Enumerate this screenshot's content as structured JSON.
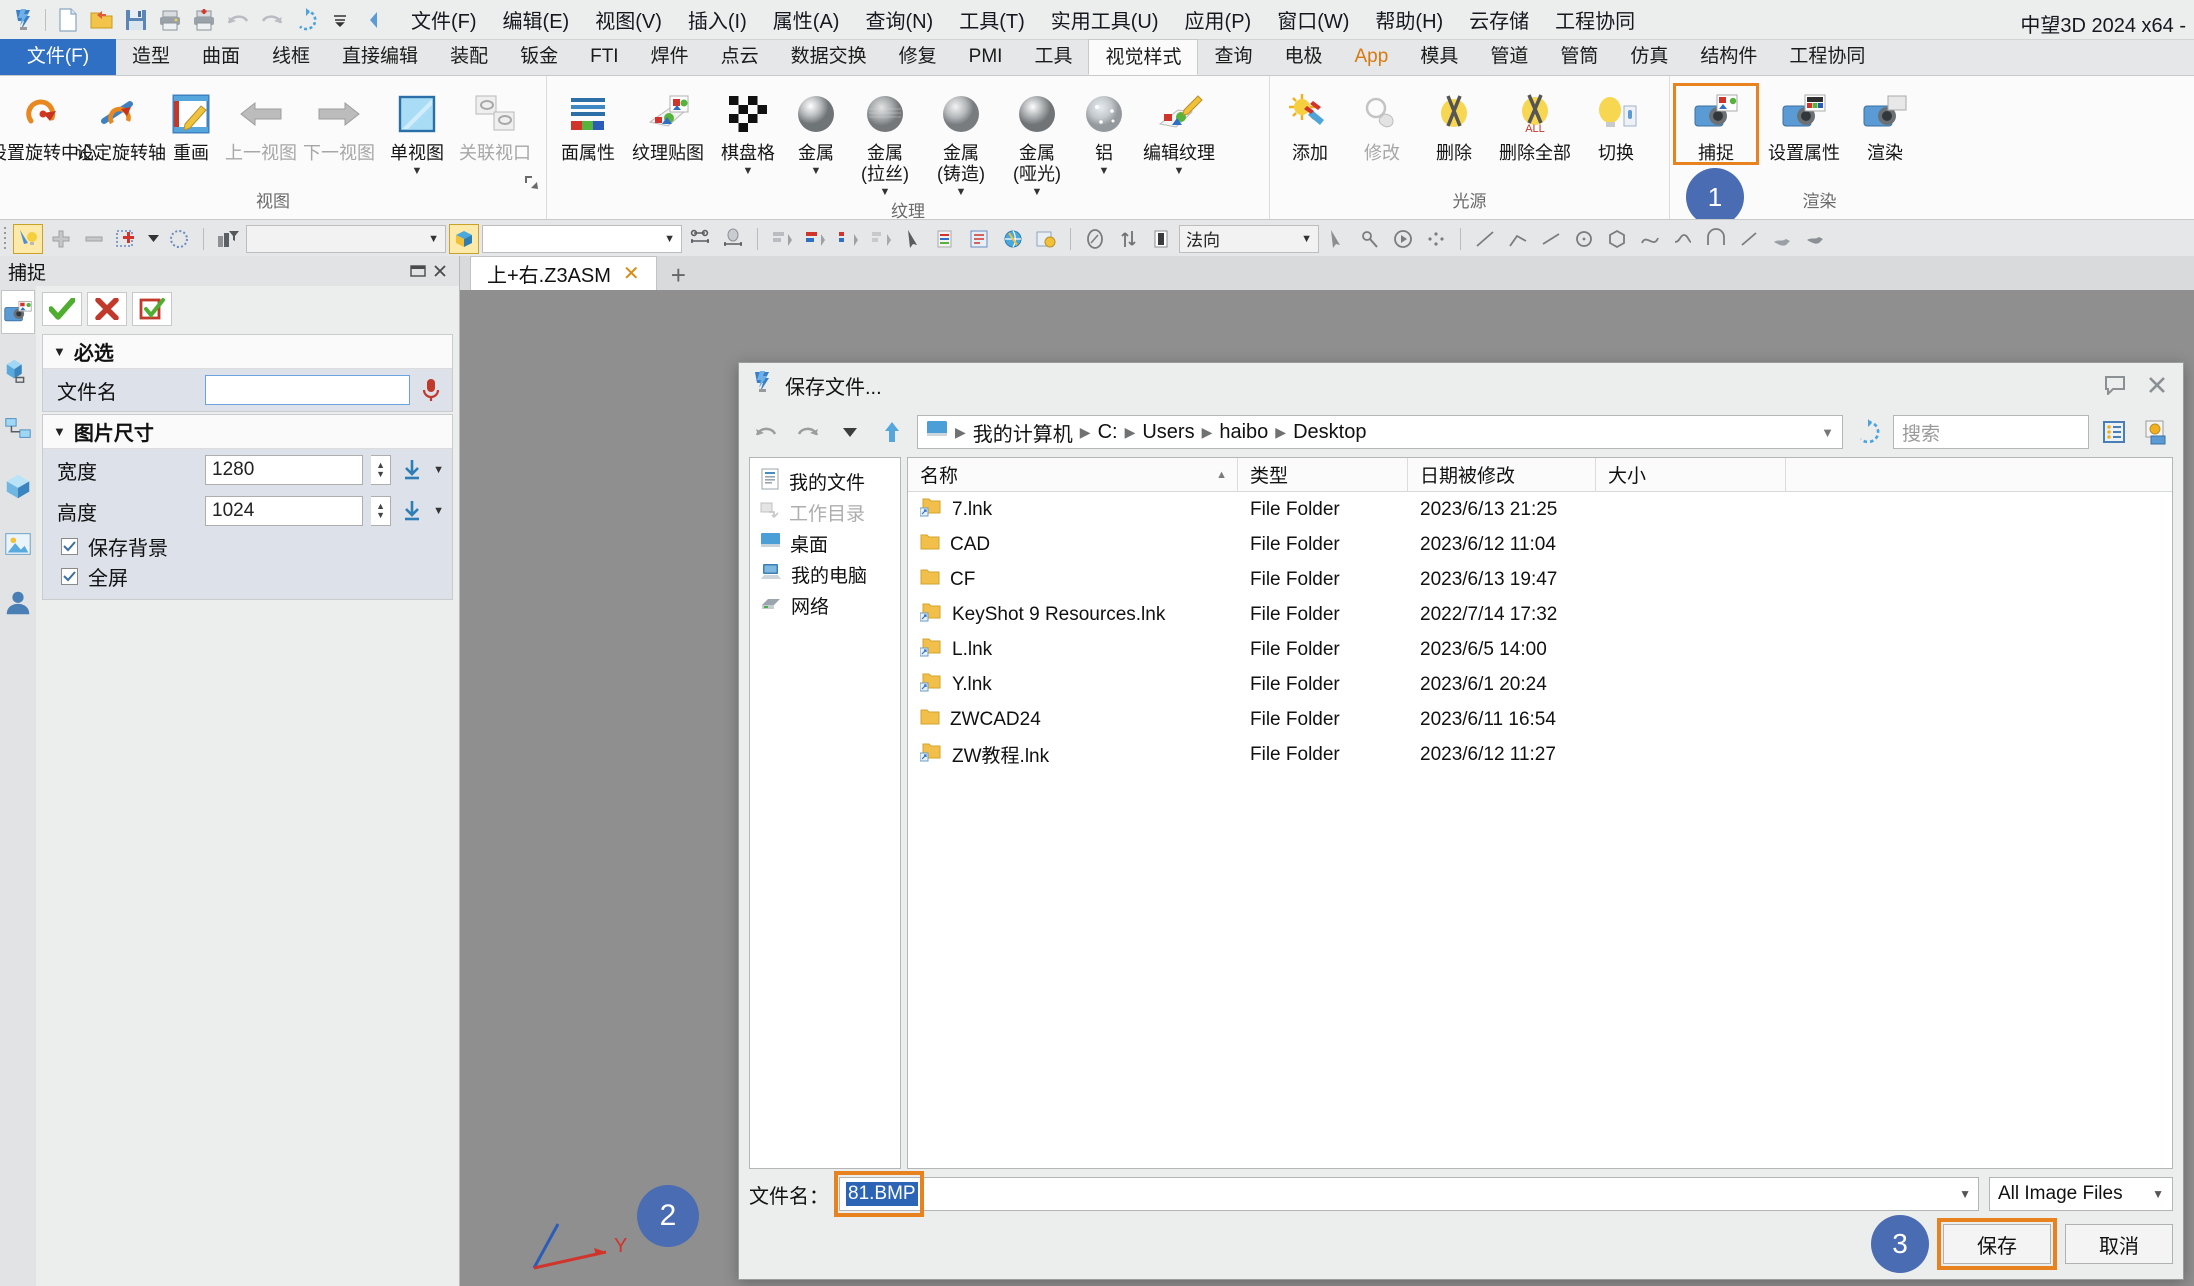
{
  "app": {
    "title": "中望3D 2024 x64 - ",
    "quick_access": [
      "logo-icon",
      "new-file-icon",
      "open-folder-icon",
      "save-icon",
      "print-icon",
      "print-preview-icon",
      "undo-icon",
      "redo-icon",
      "refresh-icon",
      "qa-dropdown-icon",
      "qa-collapse-icon"
    ],
    "menus": [
      "文件(F)",
      "编辑(E)",
      "视图(V)",
      "插入(I)",
      "属性(A)",
      "查询(N)",
      "工具(T)",
      "实用工具(U)",
      "应用(P)",
      "窗口(W)",
      "帮助(H)",
      "云存储",
      "工程协同"
    ]
  },
  "ribbon": {
    "file_tab": "文件(F)",
    "tabs": [
      "造型",
      "曲面",
      "线框",
      "直接编辑",
      "装配",
      "钣金",
      "FTI",
      "焊件",
      "点云",
      "数据交换",
      "修复",
      "PMI",
      "工具",
      "视觉样式",
      "查询",
      "电极",
      "App",
      "模具",
      "管道",
      "管筒",
      "仿真",
      "结构件",
      "工程协同"
    ],
    "active_tab": "视觉样式",
    "groups": [
      {
        "title": "视图",
        "buttons": [
          {
            "label": "设置旋转中心",
            "icon": "rotate-center-icon",
            "enabled": true,
            "caret": false
          },
          {
            "label": "设定旋转轴",
            "icon": "rotate-axis-icon",
            "enabled": true,
            "caret": false
          },
          {
            "label": "重画",
            "icon": "redraw-icon",
            "enabled": true,
            "caret": false
          },
          {
            "label": "上一视图",
            "icon": "prev-view-arrow-icon",
            "enabled": false,
            "caret": false
          },
          {
            "label": "下一视图",
            "icon": "next-view-arrow-icon",
            "enabled": false,
            "caret": false
          },
          {
            "label": "单视图",
            "icon": "single-view-icon",
            "enabled": true,
            "caret": true
          },
          {
            "label": "关联视口",
            "icon": "linked-viewport-icon",
            "enabled": false,
            "caret": false
          }
        ]
      },
      {
        "title": "纹理",
        "buttons": [
          {
            "label": "面属性",
            "icon": "face-attribute-icon",
            "enabled": true,
            "caret": false
          },
          {
            "label": "纹理贴图",
            "icon": "texture-map-icon",
            "enabled": true,
            "caret": false
          },
          {
            "label": "棋盘格",
            "icon": "checkerboard-icon",
            "enabled": true,
            "caret": true
          },
          {
            "label": "金属",
            "icon": "metal-sphere-icon",
            "enabled": true,
            "caret": true
          },
          {
            "label": "金属 (拉丝)",
            "icon": "metal-brushed-sphere-icon",
            "enabled": true,
            "caret": true
          },
          {
            "label": "金属 (铸造)",
            "icon": "metal-cast-sphere-icon",
            "enabled": true,
            "caret": true
          },
          {
            "label": "金属 (哑光)",
            "icon": "metal-matte-sphere-icon",
            "enabled": true,
            "caret": true
          },
          {
            "label": "铝",
            "icon": "aluminum-sphere-icon",
            "enabled": true,
            "caret": true
          },
          {
            "label": "编辑纹理",
            "icon": "edit-texture-icon",
            "enabled": true,
            "caret": true
          }
        ]
      },
      {
        "title": "光源",
        "buttons": [
          {
            "label": "添加",
            "icon": "add-light-icon",
            "enabled": true,
            "caret": false
          },
          {
            "label": "修改",
            "icon": "modify-light-icon",
            "enabled": false,
            "caret": false
          },
          {
            "label": "删除",
            "icon": "delete-light-icon",
            "enabled": true,
            "caret": false
          },
          {
            "label": "删除全部",
            "icon": "delete-all-lights-icon",
            "enabled": true,
            "caret": false
          },
          {
            "label": "切换",
            "icon": "toggle-light-icon",
            "enabled": true,
            "caret": false
          }
        ]
      },
      {
        "title": "渲染",
        "buttons": [
          {
            "label": "捕捉",
            "icon": "capture-camera-icon",
            "enabled": true,
            "caret": false,
            "highlight": true,
            "badge": "1"
          },
          {
            "label": "设置属性",
            "icon": "render-settings-camera-icon",
            "enabled": true,
            "caret": false
          },
          {
            "label": "渲染",
            "icon": "render-camera-icon",
            "enabled": true,
            "caret": false
          }
        ]
      }
    ]
  },
  "toolbar2": {
    "icons": [
      "select-light-icon",
      "add-plus-icon",
      "remove-minus-icon",
      "add-region-icon",
      "circle-dotted-icon",
      "filter-icon"
    ],
    "combo1_value": "",
    "combo2_icon": "shape-filter-icon",
    "combo2_value": "",
    "direction_combo": "法向"
  },
  "leftdock": {
    "title": "捕捉",
    "confirm_buttons": [
      "ok-check-button",
      "cancel-x-button",
      "apply-button"
    ],
    "sections": [
      {
        "title": "必选",
        "fields": [
          {
            "label": "文件名",
            "value": "",
            "type": "text"
          }
        ]
      },
      {
        "title": "图片尺寸",
        "fields": [
          {
            "label": "宽度",
            "value": "1280",
            "type": "spinner"
          },
          {
            "label": "高度",
            "value": "1024",
            "type": "spinner"
          }
        ],
        "checkboxes": [
          {
            "label": "保存背景",
            "checked": true
          },
          {
            "label": "全屏",
            "checked": true
          }
        ]
      }
    ]
  },
  "workspace": {
    "tab_label": "上+右.Z3ASM",
    "tab_close": "✕",
    "new_tab": "+"
  },
  "dialog": {
    "title": "保存文件...",
    "breadcrumb": [
      "我的计算机",
      "C:",
      "Users",
      "haibo",
      "Desktop"
    ],
    "search_placeholder": "搜索",
    "places": [
      {
        "label": "我的文件",
        "icon": "my-documents-icon",
        "enabled": true
      },
      {
        "label": "工作目录",
        "icon": "work-directory-icon",
        "enabled": false
      },
      {
        "label": "桌面",
        "icon": "desktop-icon",
        "enabled": true
      },
      {
        "label": "我的电脑",
        "icon": "my-computer-icon",
        "enabled": true
      },
      {
        "label": "网络",
        "icon": "network-icon",
        "enabled": true
      }
    ],
    "columns": [
      "名称",
      "类型",
      "日期被修改",
      "大小"
    ],
    "sort_column": "名称",
    "sort_direction": "asc",
    "files": [
      {
        "name": "7.lnk",
        "type": "File Folder",
        "modified": "2023/6/13 21:25",
        "size": "",
        "icon": "folder-shortcut-icon"
      },
      {
        "name": "CAD",
        "type": "File Folder",
        "modified": "2023/6/12 11:04",
        "size": "",
        "icon": "folder-icon"
      },
      {
        "name": "CF",
        "type": "File Folder",
        "modified": "2023/6/13 19:47",
        "size": "",
        "icon": "folder-icon"
      },
      {
        "name": "KeyShot 9 Resources.lnk",
        "type": "File Folder",
        "modified": "2022/7/14 17:32",
        "size": "",
        "icon": "folder-shortcut-icon"
      },
      {
        "name": "L.lnk",
        "type": "File Folder",
        "modified": "2023/6/5 14:00",
        "size": "",
        "icon": "folder-shortcut-icon"
      },
      {
        "name": "Y.lnk",
        "type": "File Folder",
        "modified": "2023/6/1 20:24",
        "size": "",
        "icon": "folder-shortcut-icon"
      },
      {
        "name": "ZWCAD24",
        "type": "File Folder",
        "modified": "2023/6/11 16:54",
        "size": "",
        "icon": "folder-icon"
      },
      {
        "name": "ZW教程.lnk",
        "type": "File Folder",
        "modified": "2023/6/12 11:27",
        "size": "",
        "icon": "folder-shortcut-icon"
      }
    ],
    "filename_label": "文件名：",
    "filename_value": "81.BMP",
    "filter_value": "All Image Files",
    "save_button": "保存",
    "cancel_button": "取消",
    "badge_filename": "2",
    "badge_save": "3"
  },
  "colors": {
    "accent_orange": "#e8821e",
    "badge_blue": "#4a6cb3",
    "ribbon_file_blue": "#2f6fc4",
    "selection_blue": "#2b63b5"
  }
}
